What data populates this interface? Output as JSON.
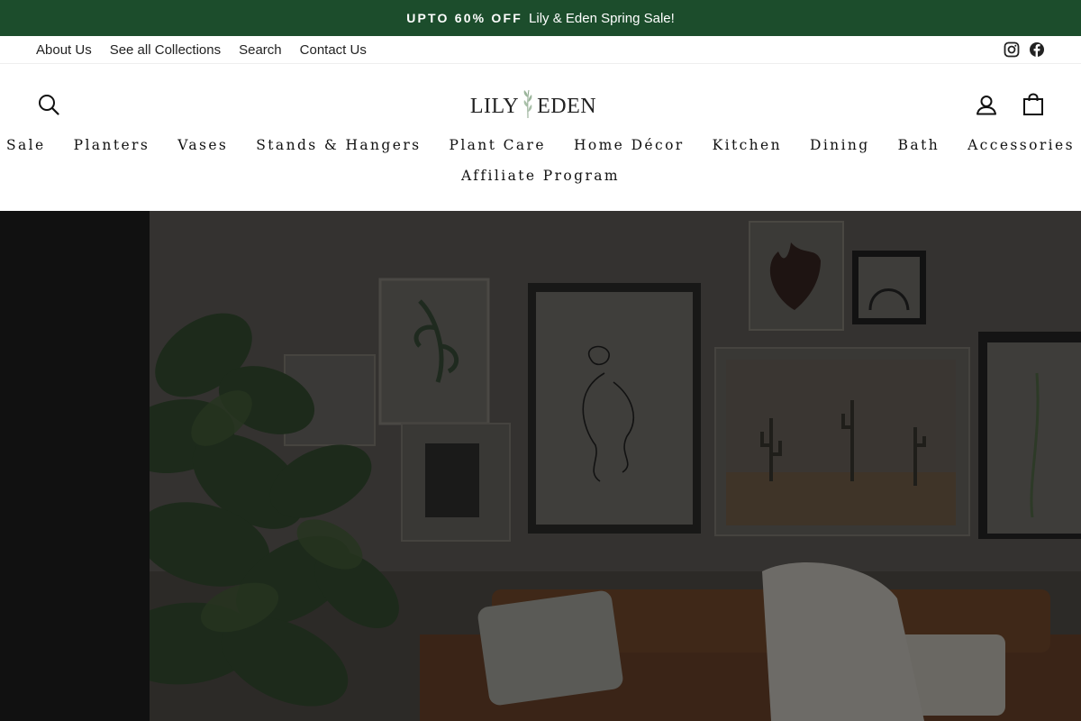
{
  "announcement": {
    "highlight": "UPTO 60% OFF",
    "text": "Lily & Eden Spring Sale!"
  },
  "utility_links": [
    "About Us",
    "See all Collections",
    "Search",
    "Contact Us"
  ],
  "social": [
    "instagram-icon",
    "facebook-icon"
  ],
  "logo": {
    "left": "LILY",
    "right": "EDEN"
  },
  "nav_row1": [
    "Sale",
    "Planters",
    "Vases",
    "Stands & Hangers",
    "Plant Care",
    "Home Décor",
    "Kitchen",
    "Dining",
    "Bath",
    "Accessories"
  ],
  "nav_row2": [
    "Affiliate Program"
  ],
  "colors": {
    "announce_bg": "#1c4d2c",
    "hero_left": "#111111"
  }
}
